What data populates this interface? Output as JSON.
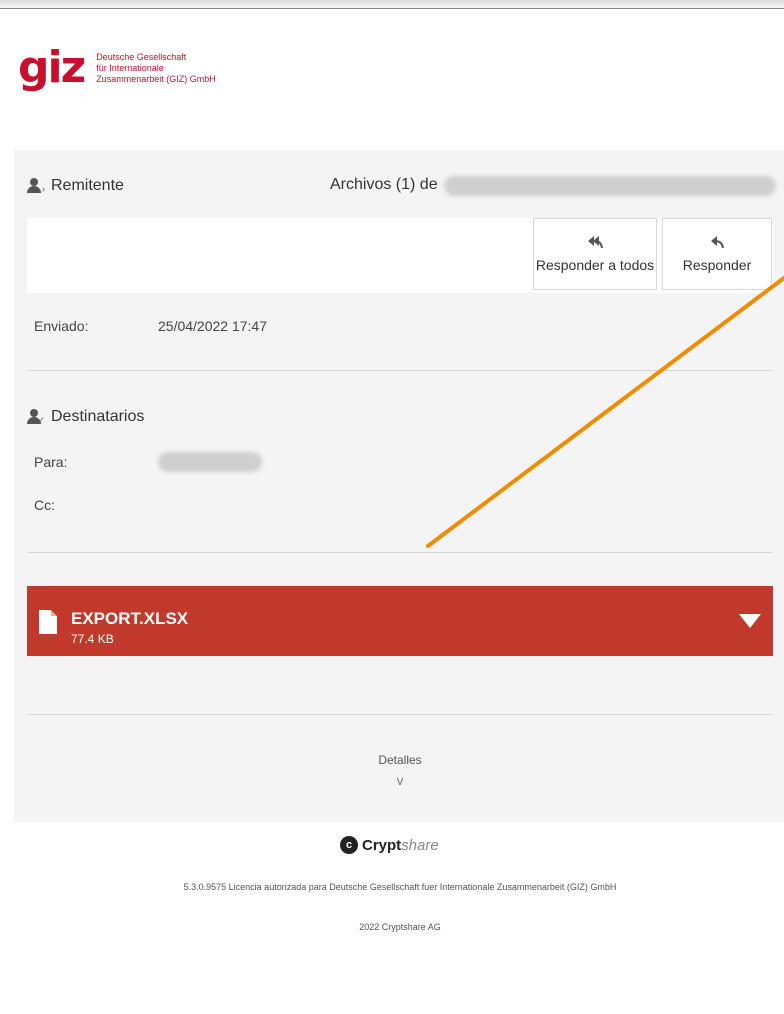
{
  "header": {
    "logo_mark": "giz",
    "logo_lines": [
      "Deutsche Gesellschaft",
      "für Internationale",
      "Zusammenarbeit (GIZ) GmbH"
    ]
  },
  "sender": {
    "section_label": "Remitente",
    "files_label": "Archivos (1) de",
    "reply_all_label": "Responder a todos",
    "reply_label": "Responder",
    "sent_label": "Enviado:",
    "sent_value": "25/04/2022 17:47"
  },
  "recipients": {
    "section_label": "Destinatarios",
    "to_label": "Para:",
    "cc_label": "Cc:"
  },
  "file": {
    "name": "EXPORT.XLSX",
    "size": "77.4 KB"
  },
  "details": {
    "label": "Detalles",
    "chevron": "v"
  },
  "footer": {
    "brand_bold": "Crypt",
    "brand_light": "share",
    "license": "5.3.0.9575 Licencia autorizada para Deutsche Gesellschaft fuer Internationale Zusammenarbeit (GIZ) GmbH",
    "copyright": "2022 Cryptshare AG"
  },
  "colors": {
    "brand_red": "#c8102e",
    "file_card": "#c0392b",
    "annotation_arrow": "#f08c00",
    "panel_bg": "#f4f4f4"
  },
  "icons": [
    "person-icon",
    "reply-all-icon",
    "reply-icon",
    "document-icon",
    "caret-down-icon",
    "cryptshare-logo-icon"
  ]
}
